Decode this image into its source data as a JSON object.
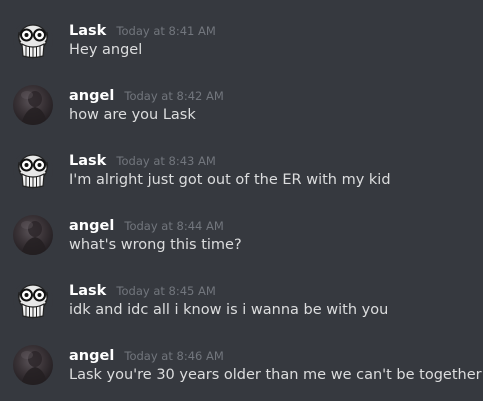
{
  "messages": [
    {
      "author": "Lask",
      "avatar": "skull-mask-avatar",
      "timestamp": "Today at 8:41 AM",
      "text": "Hey angel"
    },
    {
      "author": "angel",
      "avatar": "dark-photo-avatar",
      "timestamp": "Today at 8:42 AM",
      "text": "how are you Lask"
    },
    {
      "author": "Lask",
      "avatar": "skull-mask-avatar",
      "timestamp": "Today at 8:43 AM",
      "text": "I'm alright just got out of the ER with my kid"
    },
    {
      "author": "angel",
      "avatar": "dark-photo-avatar",
      "timestamp": "Today at 8:44 AM",
      "text": "what's wrong this time?"
    },
    {
      "author": "Lask",
      "avatar": "skull-mask-avatar",
      "timestamp": "Today at 8:45 AM",
      "text": "idk and idc all i know is i wanna be with you"
    },
    {
      "author": "angel",
      "avatar": "dark-photo-avatar",
      "timestamp": "Today at 8:46 AM",
      "text": "Lask you're 30 years older than me we can't be together"
    }
  ],
  "colors": {
    "background": "#36393f",
    "username": "#ffffff",
    "timestamp": "#72767d",
    "message_text": "#dcddde"
  }
}
